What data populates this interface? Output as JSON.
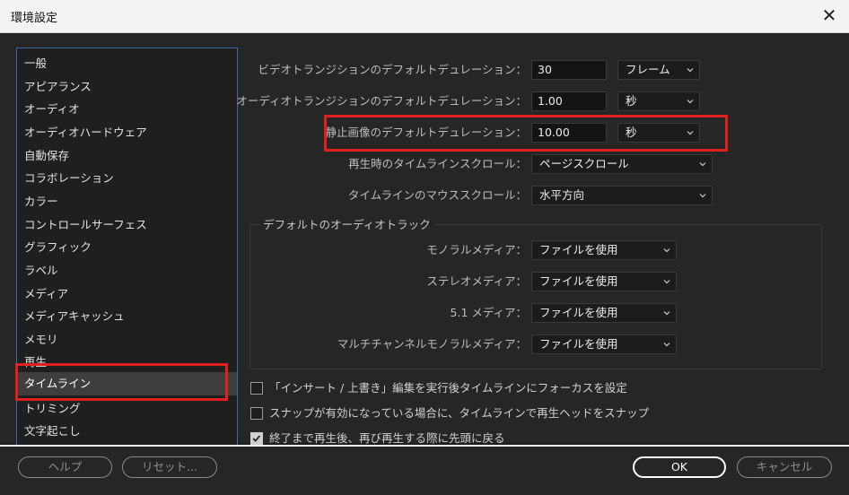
{
  "window": {
    "title": "環境設定",
    "close_glyph": "✕"
  },
  "sidebar": {
    "items": [
      {
        "label": "一般"
      },
      {
        "label": "アピアランス"
      },
      {
        "label": "オーディオ"
      },
      {
        "label": "オーディオハードウェア"
      },
      {
        "label": "自動保存"
      },
      {
        "label": "コラボレーション"
      },
      {
        "label": "カラー"
      },
      {
        "label": "コントロールサーフェス"
      },
      {
        "label": "グラフィック"
      },
      {
        "label": "ラベル"
      },
      {
        "label": "メディア"
      },
      {
        "label": "メディアキャッシュ"
      },
      {
        "label": "メモリ"
      },
      {
        "label": "再生"
      },
      {
        "label": "タイムライン"
      },
      {
        "label": "トリミング"
      },
      {
        "label": "文字起こし"
      }
    ],
    "selected": "タイムライン"
  },
  "settings": {
    "video_transition": {
      "label": "ビデオトランジションのデフォルトデュレーション：",
      "value": "30",
      "unit": "フレーム"
    },
    "audio_transition": {
      "label": "オーディオトランジションのデフォルトデュレーション：",
      "value": "1.00",
      "unit": "秒"
    },
    "still_image": {
      "label": "静止画像のデフォルトデュレーション：",
      "value": "10.00",
      "unit": "秒"
    },
    "playback_scroll": {
      "label": "再生時のタイムラインスクロール：",
      "value": "ページスクロール"
    },
    "mouse_scroll": {
      "label": "タイムラインのマウススクロール：",
      "value": "水平方向"
    }
  },
  "audio_tracks": {
    "group_title": "デフォルトのオーディオトラック",
    "mono": {
      "label": "モノラルメディア：",
      "value": "ファイルを使用"
    },
    "stereo": {
      "label": "ステレオメディア：",
      "value": "ファイルを使用"
    },
    "surround": {
      "label": "5.1 メディア：",
      "value": "ファイルを使用"
    },
    "multichannel": {
      "label": "マルチチャンネルモノラルメディア：",
      "value": "ファイルを使用"
    }
  },
  "checkboxes": [
    {
      "label": "「インサート / 上書き」編集を実行後タイムラインにフォーカスを設定",
      "checked": false
    },
    {
      "label": "スナップが有効になっている場合に、タイムラインで再生ヘッドをスナップ",
      "checked": false
    },
    {
      "label": "終了まで再生後、再び再生する際に先頭に戻る",
      "checked": true
    }
  ],
  "footer": {
    "help": "ヘルプ",
    "reset": "リセット...",
    "ok": "OK",
    "cancel": "キャンセル"
  },
  "colors": {
    "highlight": "#e0201f",
    "sidebar_border": "#3d6aa8",
    "selected_bg": "#3e3e3e"
  }
}
